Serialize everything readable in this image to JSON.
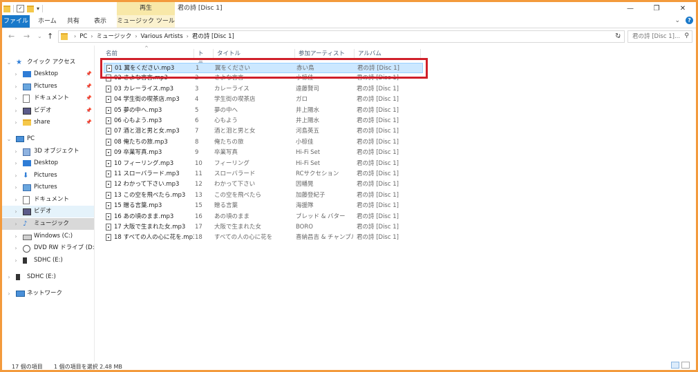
{
  "window": {
    "title": "君の詩 [Disc 1]",
    "context_header": "再生"
  },
  "ribbon": {
    "tabs": [
      "ファイル",
      "ホーム",
      "共有",
      "表示",
      "ミュージック ツール"
    ],
    "expand_glyph": "⌄",
    "help_glyph": "?"
  },
  "address": {
    "crumbs": [
      "PC",
      "ミュージック",
      "Various Artists",
      "君の詩 [Disc 1]"
    ],
    "search_placeholder": "君の詩 [Disc 1]..."
  },
  "nav": {
    "items": [
      {
        "label": "クイック アクセス",
        "icon": "star-icon",
        "level": 0,
        "expanded": true,
        "pinned": false
      },
      {
        "label": "Desktop",
        "icon": "desktop-icon",
        "level": 1,
        "pinned": true
      },
      {
        "label": "Pictures",
        "icon": "pictures-icon",
        "level": 1,
        "pinned": true
      },
      {
        "label": "ドキュメント",
        "icon": "documents-icon",
        "level": 1,
        "pinned": true
      },
      {
        "label": "ビデオ",
        "icon": "videos-icon",
        "level": 1,
        "pinned": true
      },
      {
        "label": "share",
        "icon": "folder-icon",
        "level": 1,
        "pinned": true
      },
      {
        "label": "PC",
        "icon": "pc-icon",
        "level": 0,
        "expanded": true,
        "pinned": false
      },
      {
        "label": "3D オブジェクト",
        "icon": "3d-objects-icon",
        "level": 1,
        "pinned": false
      },
      {
        "label": "Desktop",
        "icon": "desktop-icon",
        "level": 1,
        "pinned": false
      },
      {
        "label": "Pictures",
        "icon": "download-icon",
        "level": 1,
        "pinned": false
      },
      {
        "label": "Pictures",
        "icon": "pictures-icon",
        "level": 1,
        "pinned": false
      },
      {
        "label": "ドキュメント",
        "icon": "documents-icon",
        "level": 1,
        "pinned": false
      },
      {
        "label": "ビデオ",
        "icon": "videos-icon",
        "level": 1,
        "pinned": false
      },
      {
        "label": "ミュージック",
        "icon": "music-icon",
        "level": 1,
        "pinned": false
      },
      {
        "label": "Windows (C:)",
        "icon": "drive-icon",
        "level": 1,
        "pinned": false
      },
      {
        "label": "DVD RW ドライブ (D:) Audio CD",
        "icon": "dvd-icon",
        "level": 1,
        "pinned": false
      },
      {
        "label": "SDHC (E:)",
        "icon": "sd-card-icon",
        "level": 1,
        "pinned": false
      },
      {
        "label": "SDHC (E:)",
        "icon": "sd-card-icon",
        "level": 0,
        "pinned": false
      },
      {
        "label": "ネットワーク",
        "icon": "network-icon",
        "level": 0,
        "pinned": false
      }
    ]
  },
  "columns": {
    "name": "名前",
    "track": "トラ...",
    "title": "タイトル",
    "artist": "参加アーティスト",
    "album": "アルバム"
  },
  "files": [
    {
      "name": "01 翼をください.mp3",
      "track": "1",
      "title": "翼をください",
      "artist": "赤い鳥",
      "album": "君の詩 [Disc 1]"
    },
    {
      "name": "02 さよな言言.mp3",
      "track": "2",
      "title": "さよな言言",
      "artist": "小椋佳",
      "album": "君の詩 [Disc 1]"
    },
    {
      "name": "03 カレーライス.mp3",
      "track": "3",
      "title": "カレーライス",
      "artist": "遠藤賢司",
      "album": "君の詩 [Disc 1]"
    },
    {
      "name": "04 学生街の喫茶店.mp3",
      "track": "4",
      "title": "学生街の喫茶店",
      "artist": "ガロ",
      "album": "君の詩 [Disc 1]"
    },
    {
      "name": "05 夢の中へ.mp3",
      "track": "5",
      "title": "夢の中へ",
      "artist": "井上陽水",
      "album": "君の詩 [Disc 1]"
    },
    {
      "name": "06 心もよう.mp3",
      "track": "6",
      "title": "心もよう",
      "artist": "井上陽水",
      "album": "君の詩 [Disc 1]"
    },
    {
      "name": "07 酒と泪と男と女.mp3",
      "track": "7",
      "title": "酒と泪と男と女",
      "artist": "河島英五",
      "album": "君の詩 [Disc 1]"
    },
    {
      "name": "08 俺たちの旅.mp3",
      "track": "8",
      "title": "俺たちの旅",
      "artist": "小椋佳",
      "album": "君の詩 [Disc 1]"
    },
    {
      "name": "09 卒業写真.mp3",
      "track": "9",
      "title": "卒業写真",
      "artist": "Hi-Fi Set",
      "album": "君の詩 [Disc 1]"
    },
    {
      "name": "10 フィーリング.mp3",
      "track": "10",
      "title": "フィーリング",
      "artist": "Hi-Fi Set",
      "album": "君の詩 [Disc 1]"
    },
    {
      "name": "11 スローバラード.mp3",
      "track": "11",
      "title": "スローバラード",
      "artist": "RCサクセション",
      "album": "君の詩 [Disc 1]"
    },
    {
      "name": "12 わかって下さい.mp3",
      "track": "12",
      "title": "わかって下さい",
      "artist": "因幡晃",
      "album": "君の詩 [Disc 1]"
    },
    {
      "name": "13 この空を飛べたら.mp3",
      "track": "13",
      "title": "この空を飛べたら",
      "artist": "加藤登紀子",
      "album": "君の詩 [Disc 1]"
    },
    {
      "name": "15 贈る言葉.mp3",
      "track": "15",
      "title": "贈る言葉",
      "artist": "海援隊",
      "album": "君の詩 [Disc 1]"
    },
    {
      "name": "16 あの頃のまま.mp3",
      "track": "16",
      "title": "あの頃のまま",
      "artist": "ブレッド & バター",
      "album": "君の詩 [Disc 1]"
    },
    {
      "name": "17 大阪で生まれた女.mp3",
      "track": "17",
      "title": "大阪で生まれた女",
      "artist": "BORO",
      "album": "君の詩 [Disc 1]"
    },
    {
      "name": "18 すべての人の心に花を.mp3",
      "track": "18",
      "title": "すべての人の心に花を",
      "artist": "喜納昌吉 & チャンプルーズ",
      "album": "君の詩 [Disc 1]"
    }
  ],
  "status": {
    "item_count": "17 個の項目",
    "selection": "1 個の項目を選択 2.48 MB"
  },
  "colors": {
    "accent": "#1979ca",
    "selection": "#cce8ff",
    "highlight_box": "#d0202a",
    "frame": "#f39a3c"
  }
}
